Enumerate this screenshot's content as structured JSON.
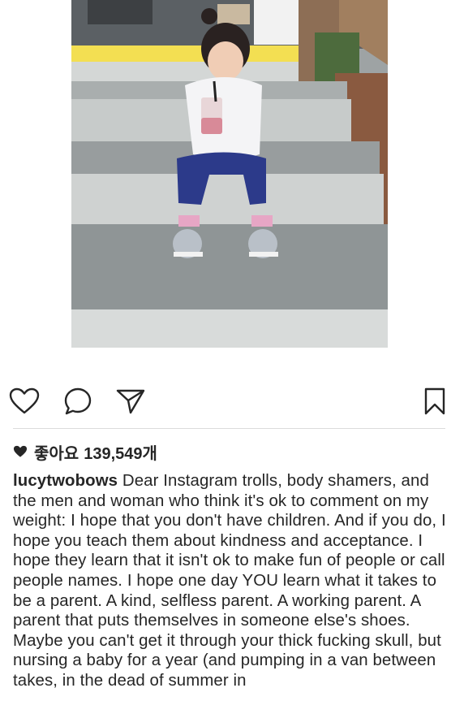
{
  "post": {
    "photo_alt": "",
    "likes_label": "좋아요",
    "likes_count": "139,549개",
    "username": "lucytwobows",
    "caption_text": "Dear Instagram trolls, body shamers, and the men and woman who think it's ok to comment on my weight: I hope that you don't have children. And if you do, I hope you teach them about kindness and acceptance. I hope they learn that it isn't ok to make fun of people or call people names. I hope one day YOU learn what it takes to be a parent. A kind, selfless parent. A working parent. A parent that puts themselves in someone else's shoes. Maybe you can't get it through your thick fucking skull, but nursing a baby for a year (and pumping in a van between takes, in the dead of summer in"
  },
  "icons": {
    "like": "heart-outline-icon",
    "comment": "comment-bubble-icon",
    "share": "paper-plane-icon",
    "save": "bookmark-icon",
    "likes_heart": "heart-filled-icon"
  },
  "colors": {
    "text": "#262626",
    "divider": "#dbdbdb",
    "background": "#ffffff"
  }
}
